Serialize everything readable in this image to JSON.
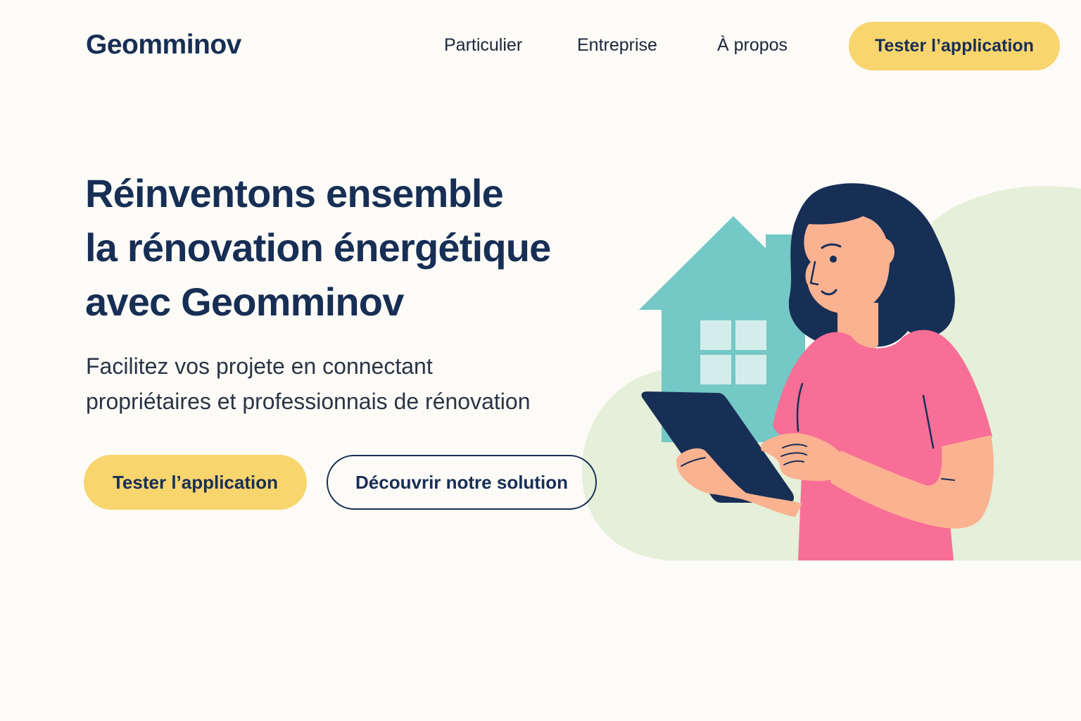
{
  "header": {
    "logo": "Geomminov",
    "nav": {
      "particulier": "Particulier",
      "entreprise": "Entreprise",
      "apropos": "À propos"
    },
    "cta": "Tester l’application"
  },
  "hero": {
    "title_lines": [
      "Réinventons ensemble",
      "la rénovation énergétique",
      "avec Geomminov"
    ],
    "subtitle_lines": [
      "Facilitez vos projete en connectant",
      "propriétaires et professionnais de rénovation"
    ],
    "primary_button": "Tester l’application",
    "secondary_button": "Découvrir notre solution"
  },
  "illustration": {
    "icons": [
      "house-icon",
      "woman-illustration",
      "tablet-icon"
    ]
  },
  "colors": {
    "navy": "#172e55",
    "yellow": "#f9d56e",
    "background": "#fcfbf7",
    "green_blob": "#e5efd9",
    "teal_house": "#74c8c6",
    "pink_shirt": "#f76e96",
    "skin": "#fbb291"
  }
}
